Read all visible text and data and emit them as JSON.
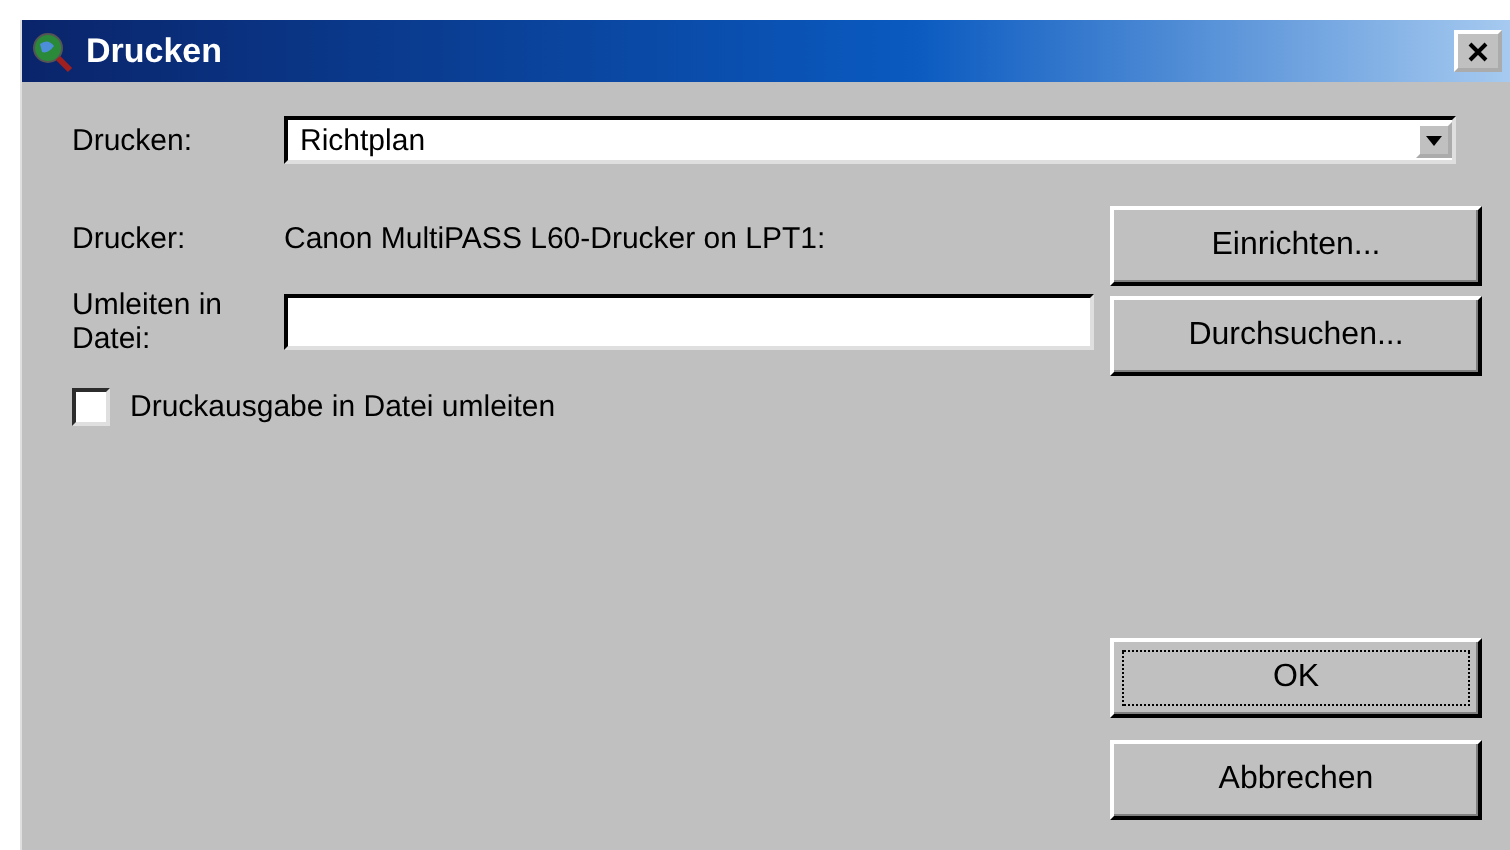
{
  "window": {
    "title": "Drucken"
  },
  "print_what": {
    "label": "Drucken:",
    "value": "Richtplan"
  },
  "printer": {
    "label": "Drucker:",
    "value": "Canon MultiPASS L60-Drucker on LPT1:"
  },
  "redirect": {
    "label": "Umleiten in Datei:"
  },
  "checkbox": {
    "label": "Druckausgabe in Datei umleiten",
    "checked": false
  },
  "buttons": [
    {
      "label": "Einrichten...",
      "focused": false
    },
    {
      "label": "Durchsuchen...",
      "focused": false
    },
    {
      "label": "OK",
      "focused": true
    },
    {
      "label": "Abbrechen",
      "focused": false
    }
  ]
}
